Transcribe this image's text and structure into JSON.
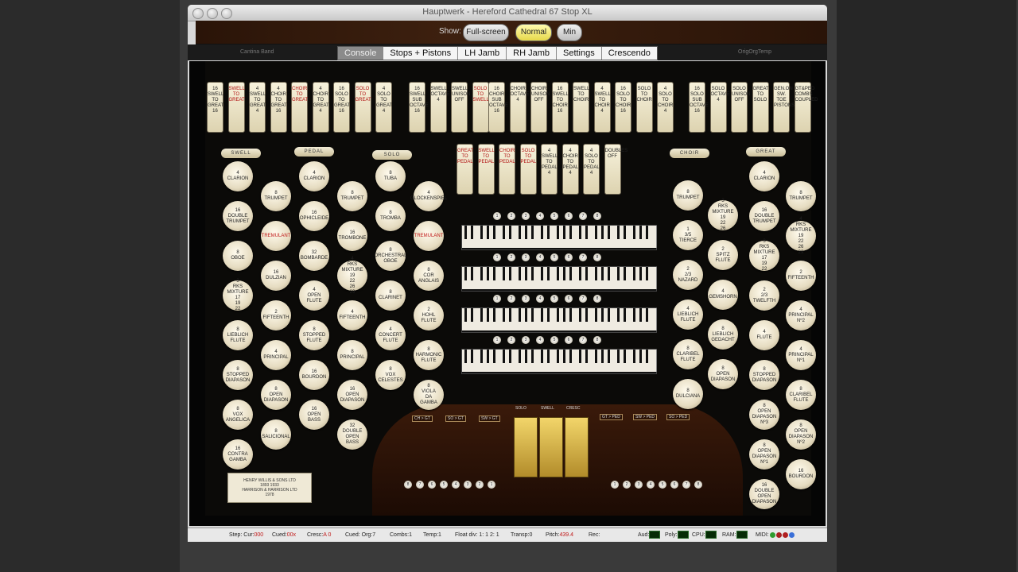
{
  "window": {
    "title": "Hauptwerk - Hereford Cathedral 67 Stop XL"
  },
  "show": {
    "label": "Show:",
    "buttons": [
      {
        "label": "Full-screen",
        "active": false
      },
      {
        "label": "Normal",
        "active": true
      },
      {
        "label": "Min",
        "active": false
      }
    ]
  },
  "tabs": {
    "left_note": "Cantina Band",
    "right_note": "OrigOrgTemp",
    "items": [
      "Console",
      "Stops + Pistons",
      "LH Jamb",
      "RH Jamb",
      "Settings",
      "Crescendo"
    ],
    "active": "Console"
  },
  "couplers_top": [
    [
      "16",
      "SWELL",
      "TO",
      "GREAT",
      "16"
    ],
    [
      "SWELL",
      "TO",
      "GREAT"
    ],
    [
      "4",
      "SWELL",
      "TO",
      "GREAT",
      "4"
    ],
    [
      "4",
      "CHOIR",
      "TO",
      "GREAT",
      "16"
    ],
    [
      "CHOIR",
      "TO",
      "GREAT"
    ],
    [
      "4",
      "CHOIR",
      "TO",
      "GREAT",
      "4"
    ],
    [
      "16",
      "SOLO",
      "TO",
      "GREAT",
      "16"
    ],
    [
      "SOLO",
      "TO",
      "GREAT"
    ],
    [
      "4",
      "SOLO",
      "TO",
      "GREAT",
      "4"
    ],
    [
      "16",
      "SWELL",
      "SUB",
      "OCTAVE",
      "16"
    ],
    [
      "SWELL",
      "OCTAVE",
      "4"
    ],
    [
      "SWELL",
      "UNISON",
      "OFF"
    ],
    [
      "SOLO",
      "TO",
      "SWELL"
    ],
    [
      "16",
      "CHOIR",
      "SUB",
      "OCTAVE",
      "16"
    ],
    [
      "CHOIR",
      "OCTAVE",
      "4"
    ],
    [
      "CHOIR",
      "UNISON",
      "OFF"
    ],
    [
      "16",
      "SWELL",
      "TO",
      "CHOIR",
      "16"
    ],
    [
      "SWELL",
      "TO",
      "CHOIR"
    ],
    [
      "4",
      "SWELL",
      "TO",
      "CHOIR",
      "4"
    ],
    [
      "16",
      "SOLO",
      "TO",
      "CHOIR",
      "16"
    ],
    [
      "SOLO",
      "TO",
      "CHOIR"
    ],
    [
      "4",
      "SOLO",
      "TO",
      "CHOIR",
      "4"
    ],
    [
      "16",
      "SOLO",
      "SUB",
      "OCTAVE",
      "16"
    ],
    [
      "SOLO",
      "OCTAVE",
      "4"
    ],
    [
      "SOLO",
      "UNISON",
      "OFF"
    ],
    [
      "GREAT",
      "TO",
      "SOLO"
    ],
    [
      "GEN.ON",
      "SW. TOE",
      "PISTONS"
    ],
    [
      "GT&PED",
      "COMBS",
      "COUPLED"
    ]
  ],
  "couplers_pedal": [
    [
      "GREAT",
      "TO",
      "PEDAL"
    ],
    [
      "SWELL",
      "TO",
      "PEDAL"
    ],
    [
      "CHOIR",
      "TO",
      "PEDAL"
    ],
    [
      "SOLO",
      "TO",
      "PEDAL"
    ],
    [
      "4",
      "SWELL",
      "TO",
      "PEDAL",
      "4"
    ],
    [
      "4",
      "CHOIR",
      "TO",
      "PEDAL",
      "4"
    ],
    [
      "4",
      "SOLO",
      "TO",
      "PEDAL",
      "4"
    ],
    [
      "DOUBLES",
      "OFF"
    ]
  ],
  "divisions": {
    "swell": "SWELL",
    "pedal": "PEDAL",
    "solo": "SOLO",
    "choir": "CHOIR",
    "great": "GREAT"
  },
  "swell_stops": [
    "4 CLARION",
    "8 TRUMPET",
    "16 DOUBLE TRUMPET",
    "TREMULANT",
    "8 OBOE",
    "16 DULZIAN",
    "3 RKS MIXTURE 17 19 22",
    "2 FIFTEENTH",
    "8 LIEBLICH FLUTE",
    "4 PRINCIPAL",
    "8 STOPPED DIAPASON",
    "8 OPEN DIAPASON",
    "8 VOX ANGELICA",
    "8 SALICIONAL",
    "16 CONTRA GAMBA"
  ],
  "pedal_stops": [
    "4 CLARION",
    "8 TRUMPET",
    "16 OPHICLEIDE",
    "16 TROMBONE",
    "32 BOMBARDE",
    "4 RKS MIXTURE 19 22 26 29",
    "4 OPEN FLUTE",
    "4 FIFTEENTH",
    "8 STOPPED FLUTE",
    "8 PRINCIPAL",
    "16 BOURDON",
    "16 OPEN DIAPASON",
    "16 OPEN BASS",
    "32 DOUBLE OPEN BASS"
  ],
  "solo_stops": [
    "8 TUBA",
    "4 GLOCKENSPIEL",
    "8 TROMBA",
    "TREMULANT",
    "8 ORCHESTRAL OBOE",
    "8 COR ANGLAIS",
    "8 CLARINET",
    "2 HOHL FLUTE",
    "4 CONCERT FLUTE",
    "8 HARMONIC FLUTE",
    "8 VOX CELESTES",
    "8 VIOLA DA GAMBA"
  ],
  "choir_stops": [
    "8 TRUMPET",
    "3 RKS MIXTURE 19 22 26",
    "1 3/5 TIERCE",
    "2 SPITZ FLUTE",
    "2 2/3 NAZARD",
    "4 GEMSHORN",
    "4 LIEBLICH FLUTE",
    "8 LIEBLICH GEDACHT",
    "8 CLARIBEL FLUTE",
    "8 OPEN DIAPASON",
    "8 DULCIANA"
  ],
  "great_stops": [
    "4 CLARION",
    "8 TRUMPET",
    "16 DOUBLE TRUMPET",
    "4 RKS MIXTURE 19 22 26 29",
    "3 RKS MIXTURE 17 19 22",
    "2 FIFTEENTH",
    "2 2/3 TWELFTH",
    "4 PRINCIPAL Nº2",
    "4 FLUTE",
    "4 PRINCIPAL Nº1",
    "8 STOPPED DIAPASON",
    "8 CLARIBEL FLUTE",
    "8 OPEN DIAPASON Nº3",
    "8 OPEN DIAPASON Nº2",
    "8 OPEN DIAPASON Nº1",
    "16 BOURDON",
    "16 DOUBLE OPEN DIAPASON"
  ],
  "nameplate": {
    "line1": "HENRY WILLIS & SONS LTD",
    "line2": "1893   1933",
    "line3": "HARRISON & HARRISON LTD",
    "line4": "1978"
  },
  "pistons": {
    "manual": [
      "1",
      "2",
      "3",
      "4",
      "5",
      "6",
      "7",
      "8"
    ],
    "pedal_left": [
      "8",
      "7",
      "6",
      "5",
      "4",
      "3",
      "2",
      "1"
    ],
    "pedal_right": [
      "1",
      "2",
      "3",
      "4",
      "5",
      "6",
      "7",
      "8"
    ]
  },
  "expression": [
    "SOLO",
    "SWELL",
    "CRESC"
  ],
  "toe_labels": [
    "CH > GT",
    "SO > GT",
    "SW > GT",
    "GT > PED",
    "SW > PED",
    "SO > PED"
  ],
  "status": {
    "step": "Step: Cur:",
    "step_val": "000",
    "cued": "Cued:",
    "cued_val": "00x",
    "cresc": "Cresc:",
    "cresc_val": "A 0",
    "cued_org": "Cued: Org:7",
    "combs": "Combs:1",
    "temp": "Temp:1",
    "float": "Float div: 1: 1 2: 1",
    "transp": "Transp:0",
    "pitch": "Pitch:",
    "pitch_val": "439.4",
    "rec": "Rec:",
    "aud": "Aud:",
    "poly": "Poly:",
    "cpu": "CPU:",
    "ram": "RAM:",
    "midi": "MIDI:"
  },
  "colors": {
    "accent_yellow": "#e6d84a",
    "stop_red": "#c01818",
    "midi_leds": [
      "#2f9b2f",
      "#a82020",
      "#b02020",
      "#3a6fd8"
    ]
  }
}
